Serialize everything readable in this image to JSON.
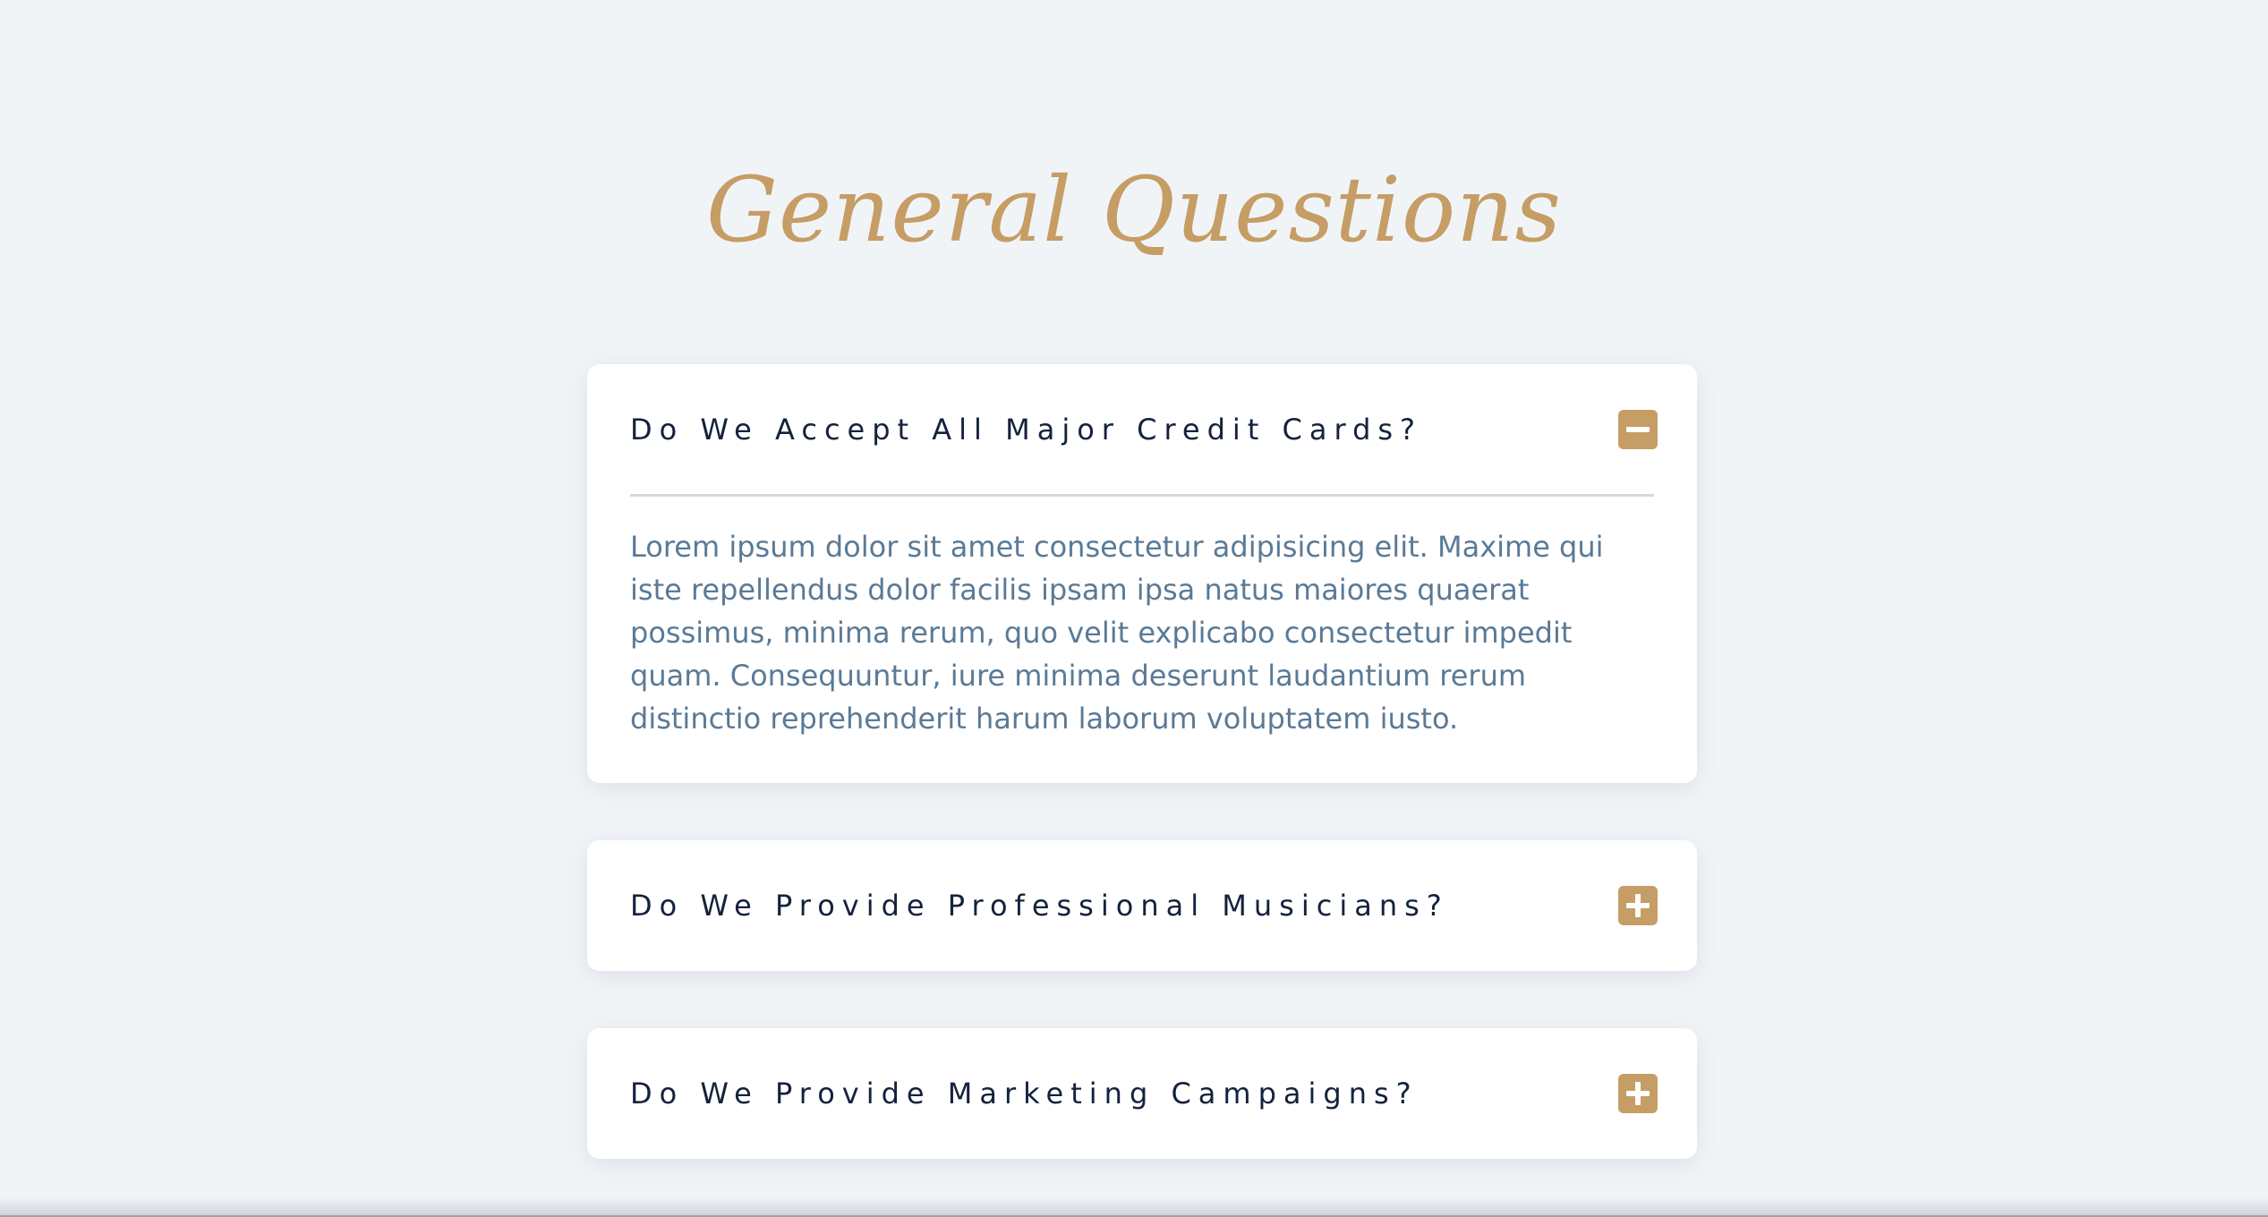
{
  "heading": "General Questions",
  "faq": [
    {
      "question": "Do We Accept All Major Credit Cards?",
      "expanded": true,
      "answer": "Lorem ipsum dolor sit amet consectetur adipisicing elit. Maxime qui iste repellendus dolor facilis ipsam ipsa natus maiores quaerat possimus, minima rerum, quo velit explicabo consectetur impedit quam. Consequuntur, iure minima deserunt laudantium rerum distinctio reprehenderit harum laborum voluptatem iusto.",
      "toggle_icon": "minus-square-icon"
    },
    {
      "question": "Do We Provide Professional Musicians?",
      "expanded": false,
      "toggle_icon": "plus-square-icon"
    },
    {
      "question": "Do We Provide Marketing Campaigns?",
      "expanded": false,
      "toggle_icon": "plus-square-icon"
    }
  ],
  "colors": {
    "background": "#f1f4f7",
    "accent": "#c59d65",
    "question_text": "#14223d",
    "answer_text": "#5a7a96",
    "card": "#ffffff"
  }
}
